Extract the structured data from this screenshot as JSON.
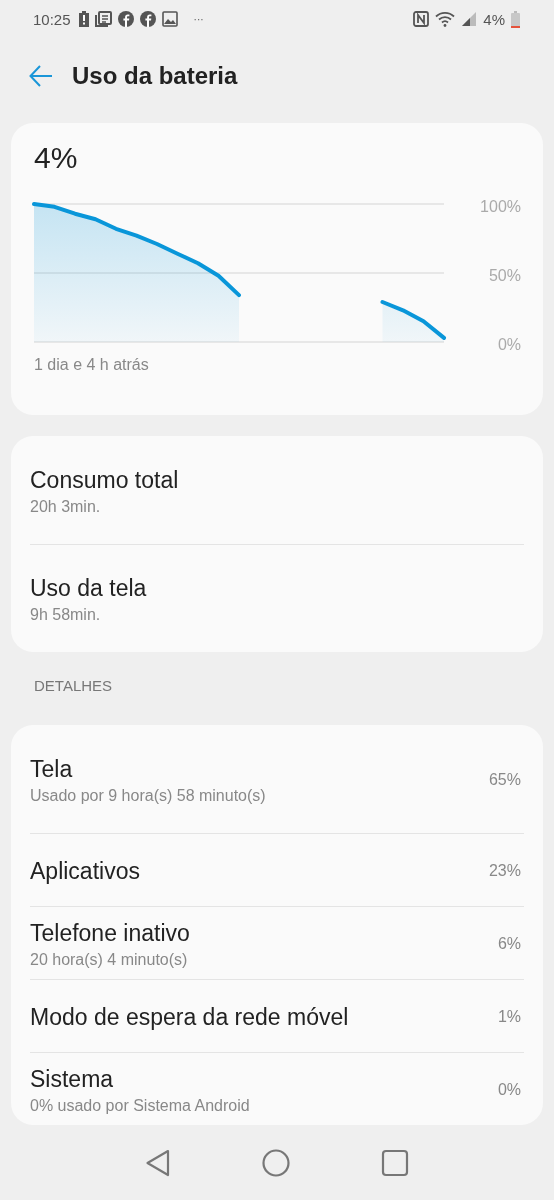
{
  "status_bar": {
    "time": "10:25",
    "more": "···",
    "battery": "4%"
  },
  "header": {
    "title": "Uso da bateria"
  },
  "battery_card": {
    "level_text": "4%",
    "caption": "1 dia e 4 h atrás",
    "axis_labels": [
      "100%",
      "50%",
      "0%"
    ]
  },
  "summary": [
    {
      "title": "Consumo total",
      "subtitle": "20h 3min."
    },
    {
      "title": "Uso da tela",
      "subtitle": "9h 58min."
    }
  ],
  "details_header": "DETALHES",
  "details": [
    {
      "title": "Tela",
      "subtitle": "Usado por 9 hora(s) 58 minuto(s)",
      "value": "65%"
    },
    {
      "title": "Aplicativos",
      "value": "23%"
    },
    {
      "title": "Telefone inativo",
      "subtitle": "20 hora(s) 4 minuto(s)",
      "value": "6%"
    },
    {
      "title": "Modo de espera da rede móvel",
      "value": "1%"
    },
    {
      "title": "Sistema",
      "subtitle": "0% usado por Sistema Android",
      "value": "0%"
    }
  ]
}
